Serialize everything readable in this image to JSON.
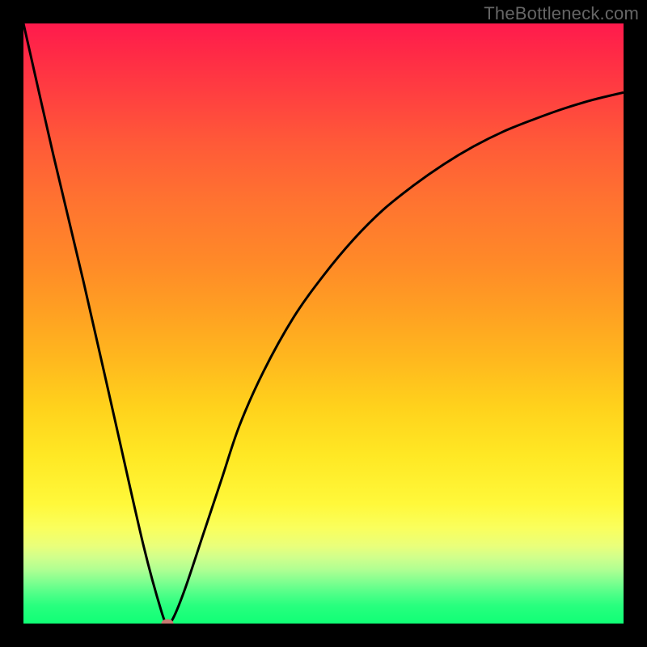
{
  "watermark": "TheBottleneck.com",
  "chart_data": {
    "type": "line",
    "title": "",
    "xlabel": "",
    "ylabel": "",
    "xlim": [
      0,
      100
    ],
    "ylim": [
      0,
      100
    ],
    "grid": false,
    "background": "red-to-green vertical gradient (high=red, low=green)",
    "series": [
      {
        "name": "bottleneck-curve",
        "x": [
          0,
          5,
          10,
          15,
          20,
          23,
          24,
          25,
          27,
          30,
          33,
          36,
          40,
          45,
          50,
          55,
          60,
          65,
          70,
          75,
          80,
          85,
          90,
          95,
          100
        ],
        "y": [
          100,
          78,
          57,
          35,
          13,
          2,
          0,
          1,
          6,
          15,
          24,
          33,
          42,
          51,
          58,
          64,
          69,
          73,
          76.5,
          79.5,
          82,
          84,
          85.8,
          87.3,
          88.5
        ]
      }
    ],
    "annotations": [
      {
        "type": "point",
        "name": "optimal-marker",
        "x": 24,
        "y": 0,
        "color": "#c77a72"
      }
    ]
  },
  "colors": {
    "curve": "#000000",
    "marker": "#c77a72",
    "frame": "#000000"
  }
}
